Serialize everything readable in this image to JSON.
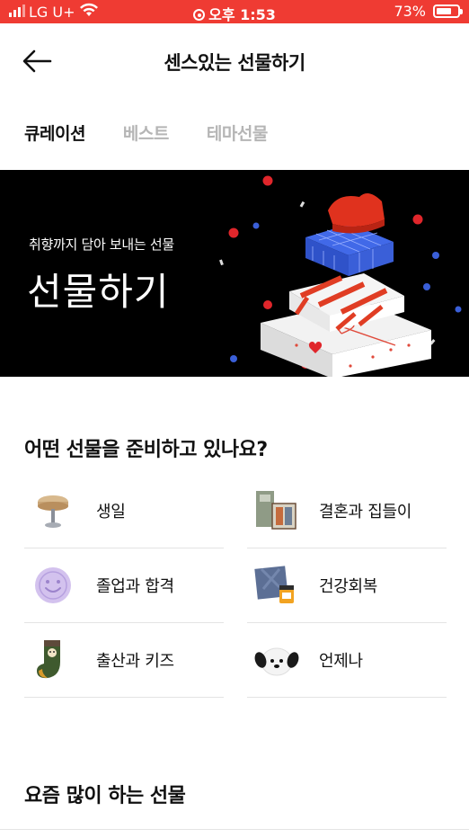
{
  "status_bar": {
    "carrier": "LG U+",
    "time": "오후 1:53",
    "battery": "73%",
    "battery_level": 0.73,
    "background": "#ef3b33"
  },
  "header": {
    "title": "센스있는 선물하기",
    "back_icon": "arrow-left-icon"
  },
  "tabs": [
    {
      "label": "큐레이션",
      "active": true
    },
    {
      "label": "베스트",
      "active": false
    },
    {
      "label": "테마선물",
      "active": false
    }
  ],
  "banner": {
    "subtitle": "취향까지 담아 보내는 선물",
    "title": "선물하기"
  },
  "occasion_section": {
    "title": "어떤 선물을 준비하고 있나요?",
    "categories": [
      {
        "label": "생일",
        "icon": "wooden-stand-icon"
      },
      {
        "label": "결혼과 집들이",
        "icon": "wedding-gift-icon"
      },
      {
        "label": "졸업과 합격",
        "icon": "smiley-coin-icon"
      },
      {
        "label": "건강회복",
        "icon": "wrapped-honey-icon"
      },
      {
        "label": "출산과 키즈",
        "icon": "baby-sock-icon"
      },
      {
        "label": "언제나",
        "icon": "puppy-plush-icon"
      }
    ]
  },
  "popular_section": {
    "title": "요즘 많이 하는 선물"
  }
}
